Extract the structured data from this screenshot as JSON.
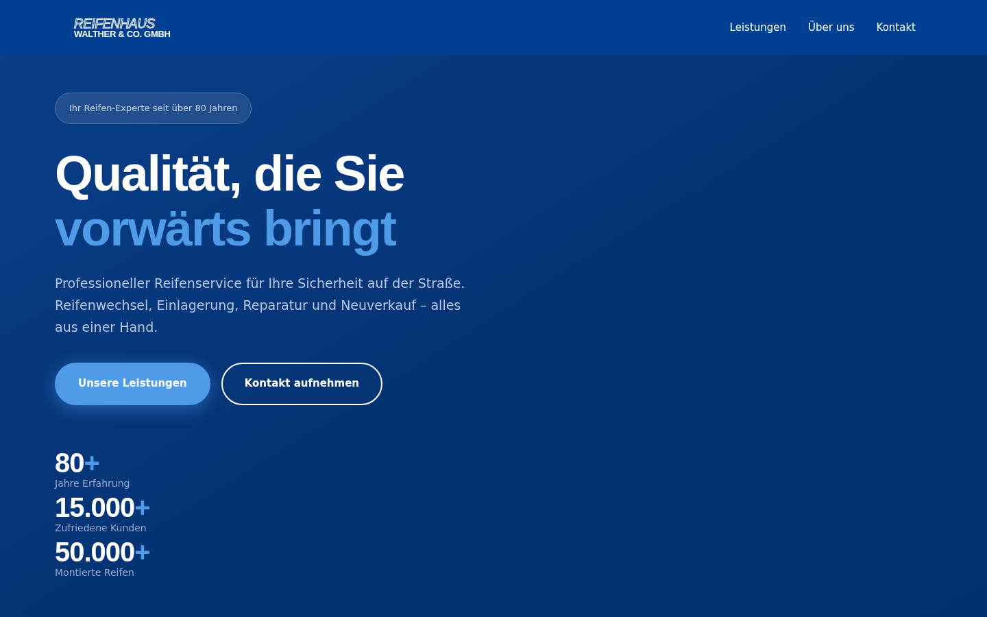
{
  "header": {
    "logo": {
      "line1": "REIFENHAUS",
      "line2": "WALTHER & CO. GMBH"
    },
    "nav": [
      {
        "label": "Leistungen"
      },
      {
        "label": "Über uns"
      },
      {
        "label": "Kontakt"
      }
    ]
  },
  "hero": {
    "badge": "Ihr Reifen-Experte seit über 80 Jahren",
    "headline": [
      "Qualität, die Sie",
      "vorwärts bringt"
    ],
    "description": "Professioneller Reifenservice für Ihre Sicherheit auf der Straße. Reifenwechsel, Einlagerung, Reparatur und Neuverkauf – alles aus einer Hand.",
    "buttons": [
      {
        "label": "Unsere Leistungen",
        "kind": "primary"
      },
      {
        "label": "Kontakt aufnehmen",
        "kind": "outline"
      }
    ],
    "stats": [
      {
        "value": "80",
        "suffix": "+",
        "label": "Jahre Erfahrung"
      },
      {
        "value": "15.000",
        "suffix": "+",
        "label": "Zufriedene Kunden"
      },
      {
        "value": "50.000",
        "suffix": "+",
        "label": "Montierte Reifen"
      }
    ]
  }
}
